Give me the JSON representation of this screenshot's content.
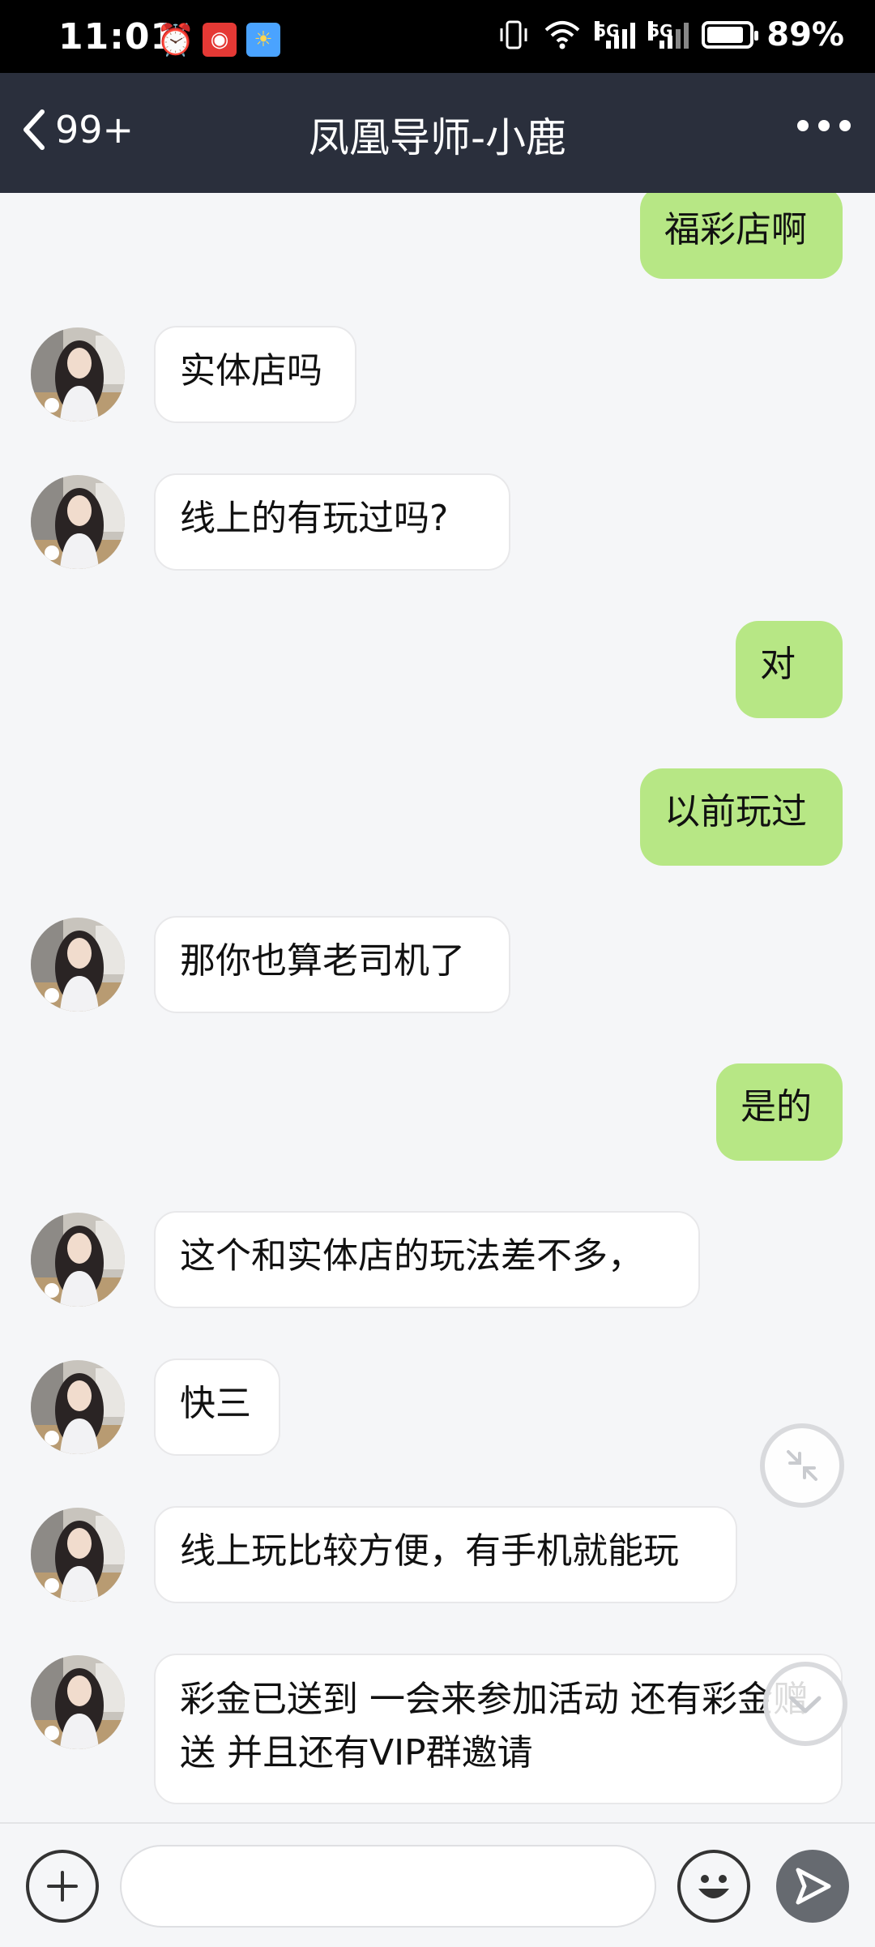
{
  "status_bar": {
    "time": "11:01",
    "battery_percent": "89%",
    "battery_level": 0.89,
    "network_labels": [
      "5G",
      "5G"
    ]
  },
  "header": {
    "back_count": "99+",
    "title": "凤凰导师-小鹿"
  },
  "messages": [
    {
      "side": "out",
      "text": "福彩店啊"
    },
    {
      "side": "in",
      "text": "实体店吗"
    },
    {
      "side": "in",
      "text": "线上的有玩过吗?"
    },
    {
      "side": "out",
      "text": "对"
    },
    {
      "side": "out",
      "text": "以前玩过"
    },
    {
      "side": "in",
      "text": "那你也算老司机了"
    },
    {
      "side": "out",
      "text": "是的"
    },
    {
      "side": "in",
      "text": "这个和实体店的玩法差不多，"
    },
    {
      "side": "in",
      "text": "快三"
    },
    {
      "side": "in",
      "text": "线上玩比较方便，有手机就能玩"
    },
    {
      "side": "in",
      "text": "彩金已送到 一会来参加活动 还有彩金赠送 并且还有VIP群邀请"
    }
  ],
  "input_bar": {
    "placeholder": ""
  },
  "colors": {
    "navbar": "#2a2f3c",
    "outgoing_bubble": "#b7e785",
    "incoming_bubble": "#ffffff",
    "background": "#f5f6f8"
  },
  "icons": {
    "back": "chevron-left-icon",
    "more": "more-dots-icon",
    "collapse": "collapse-arrows-icon",
    "scroll_down": "chevron-down-icon",
    "add": "plus-icon",
    "emoji": "smiley-icon",
    "send": "send-icon"
  }
}
